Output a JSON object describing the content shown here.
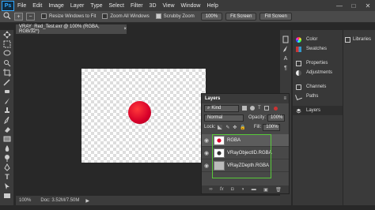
{
  "app": {
    "logo": "Ps"
  },
  "menu": [
    "File",
    "Edit",
    "Image",
    "Layer",
    "Type",
    "Select",
    "Filter",
    "3D",
    "View",
    "Window",
    "Help"
  ],
  "window_controls": {
    "minimize": "—",
    "maximize": "□",
    "close": "✕"
  },
  "options_bar": {
    "resize_label": "Resize Windows to Fit",
    "zoom_all_label": "Zoom All Windows",
    "scrubby_label": "Scrubby Zoom",
    "zoom_value": "100%",
    "fit_screen": "Fit Screen",
    "fill_screen": "Fill Screen"
  },
  "doc_tab": {
    "title": "VRAY_Red_Test.exr @ 100% (RGBA, RGB/32*)",
    "close": "×"
  },
  "status": {
    "zoom": "100%",
    "doc": "Doc: 3.52M/7.50M"
  },
  "panels": [
    {
      "label": "Color",
      "icon": "color-wheel-icon"
    },
    {
      "label": "Swatches",
      "icon": "swatches-icon"
    },
    {
      "label": "Properties",
      "icon": "properties-icon"
    },
    {
      "label": "Adjustments",
      "icon": "adjustments-icon"
    },
    {
      "label": "Channels",
      "icon": "channels-icon"
    },
    {
      "label": "Paths",
      "icon": "paths-icon"
    },
    {
      "label": "Layers",
      "icon": "layers-icon"
    }
  ],
  "libraries": {
    "label": "Libraries"
  },
  "layers_panel": {
    "title": "Layers",
    "kind": "Kind",
    "blend_mode": "Normal",
    "opacity_label": "Opacity:",
    "opacity_value": "100%",
    "lock_label": "Lock:",
    "fill_label": "Fill:",
    "fill_value": "100%",
    "layers": [
      {
        "name": "RGBA",
        "thumb": "red-dot"
      },
      {
        "name": "VRayObjectID.RGBA",
        "thumb": "dark-dot"
      },
      {
        "name": "VRayZDepth.RGBA",
        "thumb": "grey"
      }
    ],
    "footer_icons": [
      "link-icon",
      "fx-icon",
      "mask-icon",
      "adjustment-icon",
      "folder-icon",
      "new-layer-icon",
      "trash-icon"
    ]
  }
}
